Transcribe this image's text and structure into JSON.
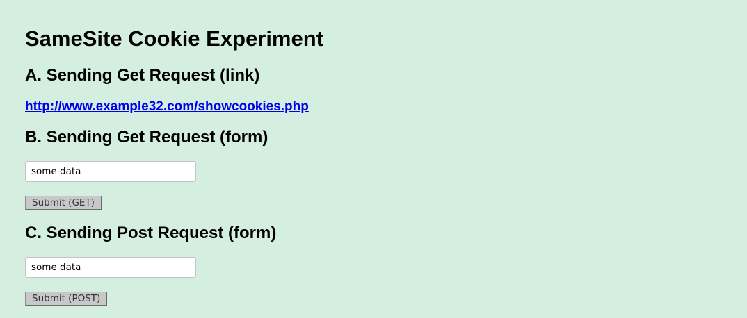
{
  "page": {
    "title": "SameSite Cookie Experiment"
  },
  "section_a": {
    "heading": "A. Sending Get Request (link)",
    "link_text": "http://www.example32.com/showcookies.php"
  },
  "section_b": {
    "heading": "B. Sending Get Request (form)",
    "input_value": "some data",
    "submit_label": "Submit (GET)"
  },
  "section_c": {
    "heading": "C. Sending Post Request (form)",
    "input_value": "some data",
    "submit_label": "Submit (POST)"
  },
  "colors": {
    "background": "#d4eedf",
    "link": "#0000ee",
    "button_face": "#c8c8c8"
  }
}
